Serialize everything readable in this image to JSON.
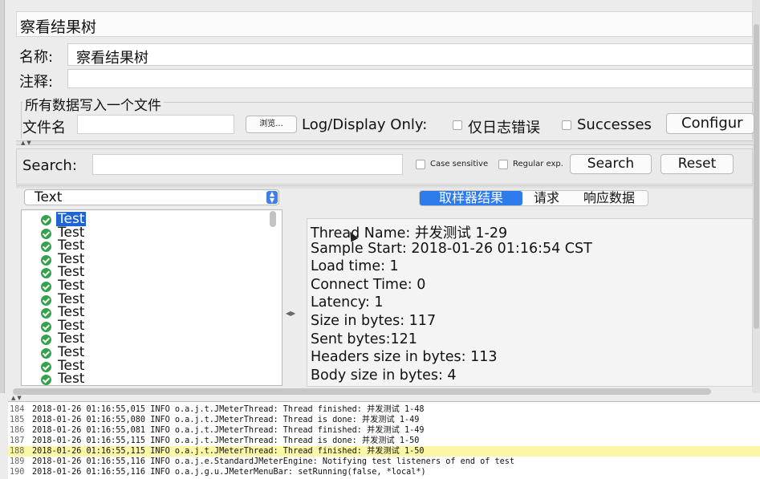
{
  "window": {
    "title": "察看结果树"
  },
  "form": {
    "name_label": "名称:",
    "name_value": "察看结果树",
    "comment_label": "注释:",
    "comment_value": ""
  },
  "file_group": {
    "title": "所有数据写入一个文件",
    "file_label": "文件名",
    "file_value": "",
    "browse_label": "浏览...",
    "log_display_label": "Log/Display Only:",
    "errors_only_label": "仅日志错误",
    "errors_only_checked": false,
    "successes_label": "Successes",
    "successes_checked": false,
    "configure_label": "Configur"
  },
  "search": {
    "label": "Search:",
    "value": "",
    "case_sensitive_label": "Case sensitive",
    "case_sensitive_checked": false,
    "regex_label": "Regular exp.",
    "regex_checked": false,
    "search_button": "Search",
    "reset_button": "Reset"
  },
  "renderer": {
    "selected": "Text"
  },
  "tree": {
    "items": [
      "Test",
      "Test",
      "Test",
      "Test",
      "Test",
      "Test",
      "Test",
      "Test",
      "Test",
      "Test",
      "Test",
      "Test",
      "Test"
    ],
    "selected_index": 0,
    "status_icon": "success-check-icon"
  },
  "tabs": {
    "items": [
      "取样器结果",
      "请求",
      "响应数据"
    ],
    "active_index": 0
  },
  "result": {
    "lines": [
      "Thread Name: 并发测试 1-29",
      "Sample Start: 2018-01-26 01:16:54 CST",
      "Load time: 1",
      "Connect Time: 0",
      "Latency: 1",
      "Size in bytes: 117",
      "Sent bytes:121",
      "Headers size in bytes: 113",
      "Body size in bytes: 4"
    ]
  },
  "log": {
    "highlight_line": 188,
    "lines": [
      {
        "num": "184",
        "text": "2018-01-26 01:16:55,015 INFO o.a.j.t.JMeterThread: Thread finished: 并发测试 1-48"
      },
      {
        "num": "185",
        "text": "2018-01-26 01:16:55,080 INFO o.a.j.t.JMeterThread: Thread is done: 并发测试 1-49"
      },
      {
        "num": "186",
        "text": "2018-01-26 01:16:55,081 INFO o.a.j.t.JMeterThread: Thread finished: 并发测试 1-49"
      },
      {
        "num": "187",
        "text": "2018-01-26 01:16:55,115 INFO o.a.j.t.JMeterThread: Thread is done: 并发测试 1-50"
      },
      {
        "num": "188",
        "text": "2018-01-26 01:16:55,115 INFO o.a.j.t.JMeterThread: Thread finished: 并发测试 1-50"
      },
      {
        "num": "189",
        "text": "2018-01-26 01:16:55,116 INFO o.a.j.e.StandardJMeterEngine: Notifying test listeners of end of test"
      },
      {
        "num": "190",
        "text": "2018-01-26 01:16:55,116 INFO o.a.j.g.u.JMeterMenuBar: setRunning(false, *local*)"
      }
    ]
  },
  "colors": {
    "selection": "#1d63d6",
    "tab_active": "#2e7bec",
    "success": "#34a14c",
    "log_highlight": "#fbf7a6"
  }
}
